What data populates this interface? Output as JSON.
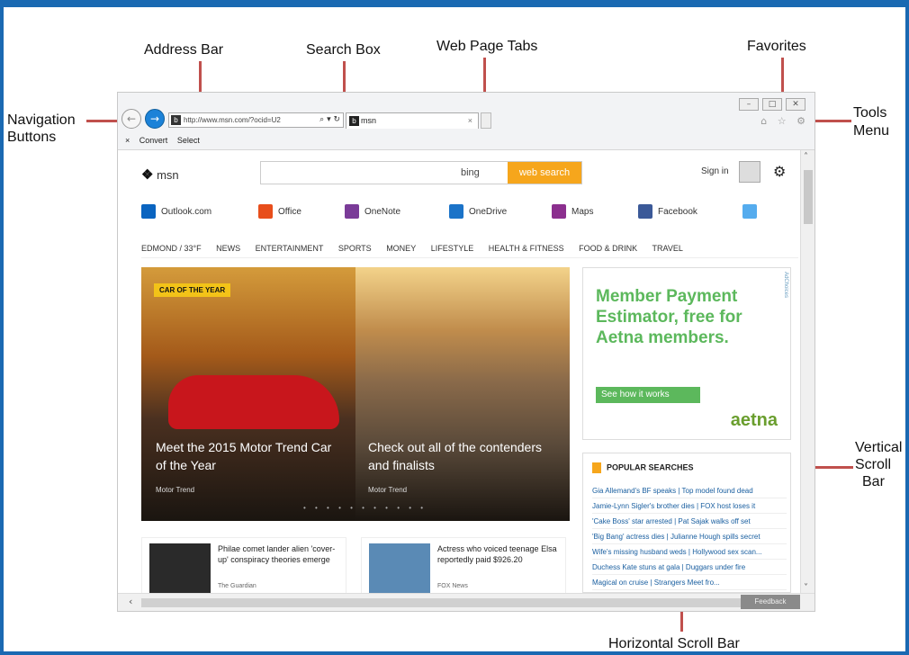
{
  "callouts": {
    "address_bar": "Address Bar",
    "search_box": "Search Box",
    "web_page_tabs": "Web Page Tabs",
    "favorites": "Favorites",
    "navigation_buttons_1": "Navigation",
    "navigation_buttons_2": "Buttons",
    "tools_menu_1": "Tools",
    "tools_menu_2": "Menu",
    "vertical_scroll_1": "Vertical",
    "vertical_scroll_2": "Scroll",
    "vertical_scroll_3": "Bar",
    "horizontal_scroll": "Horizontal Scroll Bar"
  },
  "browser": {
    "back_icon": "back-arrow-icon",
    "forward_icon": "forward-arrow-icon",
    "address_url": "http://www.msn.com/?ocid=U2",
    "address_controls": "⌕ ▾ ↻",
    "tab_title": "msn",
    "tab_close": "×",
    "win_min": "–",
    "win_max": "□",
    "win_close": "✕",
    "toolbar_icons": "⌂ ☆ ⚙",
    "cmd_close": "×",
    "cmd_convert": "Convert",
    "cmd_select": "Select"
  },
  "msn": {
    "logo": "msn",
    "bing": "bing",
    "search_button": "web search",
    "sign_in": "Sign in",
    "apps": [
      "Outlook.com",
      "Office",
      "OneNote",
      "OneDrive",
      "Maps",
      "Facebook"
    ],
    "location": "EDMOND / 33°F",
    "categories": [
      "NEWS",
      "ENTERTAINMENT",
      "SPORTS",
      "MONEY",
      "LIFESTYLE",
      "HEALTH & FITNESS",
      "FOOD & DRINK",
      "TRAVEL"
    ],
    "hero": {
      "badge": "CAR OF THE YEAR",
      "caption1": "Meet the 2015 Motor Trend Car of the Year",
      "source1": "Motor Trend",
      "caption2": "Check out all of the contenders and finalists",
      "source2": "Motor Trend",
      "dots": "• • • • • • • • • • •"
    },
    "ad": {
      "headline": "Member Payment Estimator, free for Aetna members.",
      "cta": "See how it works",
      "brand": "aetna",
      "choices": "AdChoices"
    },
    "popular": {
      "title": "POPULAR SEARCHES",
      "rows": [
        "Gia Allemand's BF speaks | Top model found dead",
        "Jamie-Lynn Sigler's brother dies | FOX host loses it",
        "'Cake Boss' star arrested | Pat Sajak walks off set",
        "'Big Bang' actress dies | Julianne Hough spills secret",
        "Wife's missing husband weds | Hollywood sex scan...",
        "Duchess Kate stuns at gala | Duggars under fire",
        "Magical on cruise | Strangers Meet fro..."
      ]
    },
    "cards": [
      {
        "title": "Philae comet lander alien 'cover-up' conspiracy theories emerge",
        "source": "The Guardian"
      },
      {
        "title": "Actress who voiced teenage Elsa reportedly paid $926.20",
        "source": "FOX News"
      }
    ],
    "feedback": "Feedback"
  }
}
